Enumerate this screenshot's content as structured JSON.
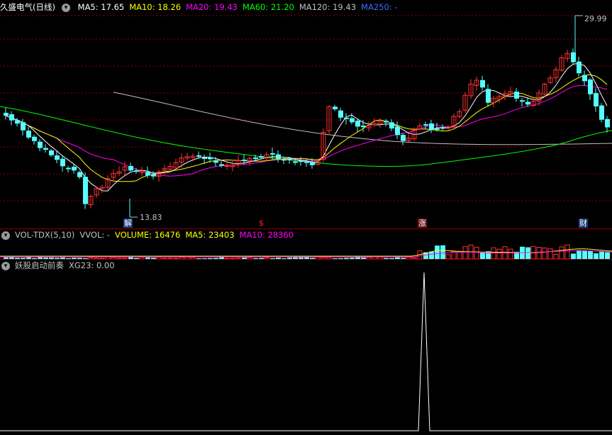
{
  "main": {
    "stock_name": "久盛电气",
    "period": "(日线)",
    "ma": [
      {
        "label": "MA5: 17.65",
        "color": "#ffffff"
      },
      {
        "label": "MA10: 18.26",
        "color": "#ffff00"
      },
      {
        "label": "MA20: 19.43",
        "color": "#ff00ff"
      },
      {
        "label": "MA60: 21.20",
        "color": "#00ff00"
      },
      {
        "label": "MA120: 19.43",
        "color": "#c0c0c0"
      },
      {
        "label": "MA250: -",
        "color": "#3c6cff"
      }
    ],
    "high_label": "29.99",
    "low_label": "13.83",
    "markers": [
      {
        "text": "解",
        "color": "#ffffff",
        "bg": "#1b3b7a"
      },
      {
        "text": "$",
        "color": "#ff2020",
        "bg": "transparent"
      },
      {
        "text": "涨",
        "color": "#ffffff",
        "bg": "#6a1010"
      },
      {
        "text": "财",
        "color": "#ffffff",
        "bg": "#1b3b7a"
      }
    ]
  },
  "volume": {
    "title": "VOL-TDX(5,10)",
    "vvol": "VVOL: -",
    "volume": "VOLUME: 16476",
    "ma5": "MA5: 23403",
    "ma10": "MA10: 28360"
  },
  "indicator": {
    "title": "妖股启动前奏",
    "value": "XG23: 0.00"
  },
  "colors": {
    "up": "#ff3232",
    "down": "#54ffff",
    "grid": "#8b0000",
    "ma5": "#ffffff",
    "ma10": "#ffff00",
    "ma20": "#ff00ff",
    "ma60": "#00ff00",
    "ma120": "#c0c0c0"
  },
  "chart_data": {
    "type": "candlestick",
    "price_range": [
      13.83,
      29.99
    ],
    "ma_last": {
      "MA5": 17.65,
      "MA10": 18.26,
      "MA20": 19.43,
      "MA60": 21.2,
      "MA120": 19.43
    },
    "volume_last": {
      "VOLUME": 16476,
      "MA5": 23403,
      "MA10": 28360
    },
    "XG23_last": 0.0
  }
}
